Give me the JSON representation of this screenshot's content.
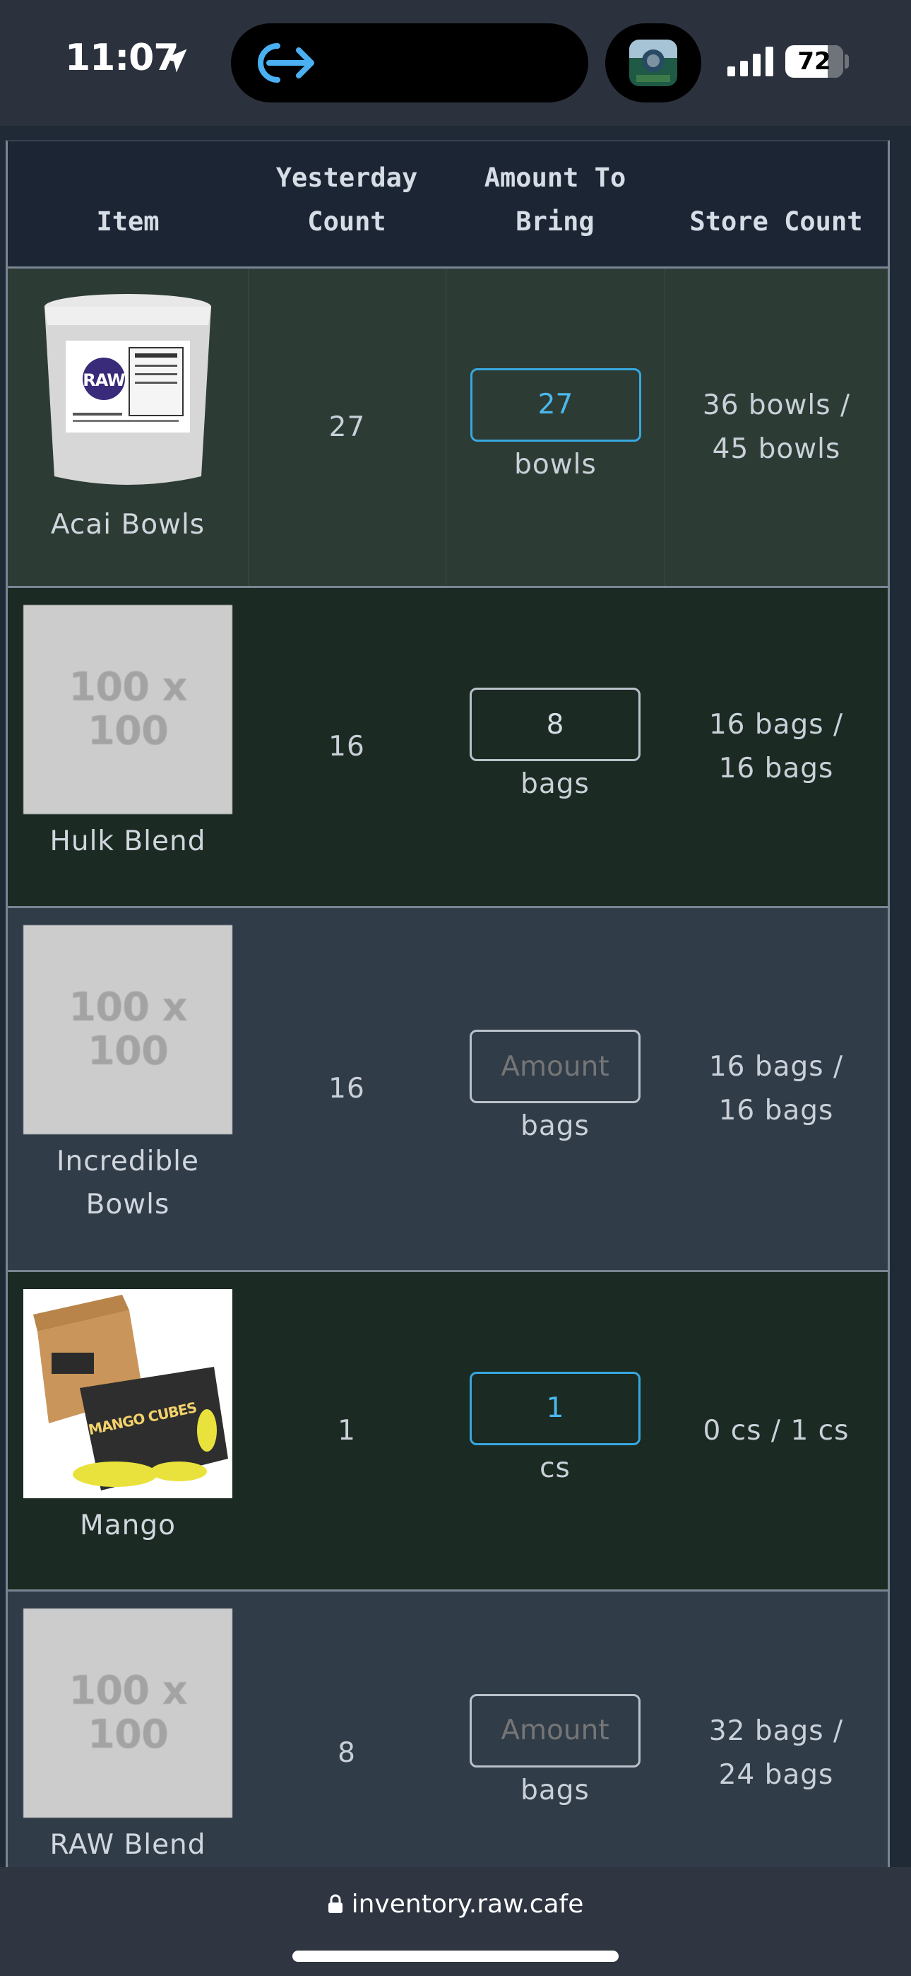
{
  "status_bar": {
    "time": "11:07",
    "battery_level": "72",
    "icons": [
      "location-arrow-icon",
      "logout-arrow-icon",
      "app-thumbnail-icon",
      "cellular-signal-icon",
      "battery-icon"
    ]
  },
  "table": {
    "headers": {
      "item": "Item",
      "yesterday": "Yesterday Count",
      "amount": "Amount To Bring",
      "store": "Store Count"
    },
    "rows": [
      {
        "name": "Acai Bowls",
        "thumb_label": "",
        "yesterday": "27",
        "amount_value": "27",
        "amount_placeholder": "Amount",
        "unit": "bowls",
        "store": "36 bowls / 45 bowls"
      },
      {
        "name": "Hulk Blend",
        "thumb_label": "100 x 100",
        "yesterday": "16",
        "amount_value": "8",
        "amount_placeholder": "Amount",
        "unit": "bags",
        "store": "16 bags / 16 bags"
      },
      {
        "name": "Incredible Bowls",
        "thumb_label": "100 x 100",
        "yesterday": "16",
        "amount_value": "",
        "amount_placeholder": "Amount",
        "unit": "bags",
        "store": "16 bags / 16 bags"
      },
      {
        "name": "Mango",
        "thumb_label": "",
        "yesterday": "1",
        "amount_value": "1",
        "amount_placeholder": "Amount",
        "unit": "cs",
        "store": "0 cs / 1 cs"
      },
      {
        "name": "RAW Blend",
        "thumb_label": "100 x 100",
        "yesterday": "8",
        "amount_value": "",
        "amount_placeholder": "Amount",
        "unit": "bags",
        "store": "32 bags / 24 bags"
      }
    ]
  },
  "browser": {
    "url": "inventory.raw.cafe"
  },
  "colors": {
    "active_input": "#37a8e0",
    "selected_row": "#2d3b35",
    "green_row": "#1b2a22",
    "slate_row": "#313c49"
  }
}
